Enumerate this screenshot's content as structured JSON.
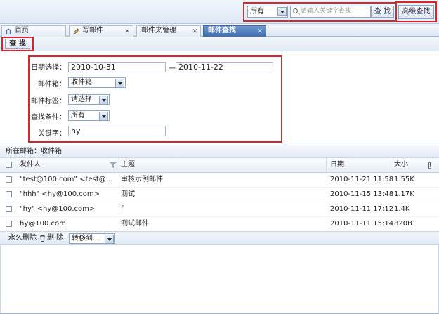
{
  "search": {
    "scope_value": "所有",
    "placeholder": "请输入关键字查找",
    "search_label": "查 找",
    "advanced_label": "高级查找"
  },
  "tabs": [
    {
      "label": "首页",
      "icon": "home-icon"
    },
    {
      "label": "写邮件",
      "icon": "pencil-icon"
    },
    {
      "label": "邮件夹管理",
      "icon": ""
    },
    {
      "label": "邮件查找",
      "icon": ""
    }
  ],
  "toolbar": {
    "find_label": "查 找"
  },
  "form": {
    "date_label": "日期选择：",
    "date_from": "2010-10-31",
    "date_sep": "一",
    "date_to": "2010-11-22",
    "mailbox_label": "邮件箱：",
    "mailbox_value": "收件箱",
    "tag_label": "邮件标签：",
    "tag_value": "请选择",
    "cond_label": "查找条件：",
    "cond_value": "所有",
    "keyword_label": "关键字：",
    "keyword_value": "hy"
  },
  "list": {
    "location": "所在邮箱：收件箱",
    "headers": {
      "sender": "发件人",
      "subject": "主题",
      "date": "日期",
      "size": "大小"
    },
    "rows": [
      {
        "sender": "\"test@100.com\" <test@...",
        "subject": "审核示例邮件",
        "date": "2010-11-21 11:58",
        "size": "1.55K"
      },
      {
        "sender": "\"hhh\" <hy@100.com>",
        "subject": "测试",
        "date": "2010-11-15 13:48",
        "size": "1.17K"
      },
      {
        "sender": "\"hy\" <hy@100.com>",
        "subject": "f",
        "date": "2010-11-11 17:12",
        "size": "1.4K"
      },
      {
        "sender": "hy@100.com",
        "subject": "测试邮件",
        "date": "2010-11-11 15:14",
        "size": "820B"
      }
    ],
    "bottom": {
      "perm_delete": "永久删除",
      "delete": "删 除",
      "move_to": "转移到..."
    }
  },
  "colors": {
    "highlight": "#d8262c",
    "active_tab": "#3f6fb2"
  }
}
